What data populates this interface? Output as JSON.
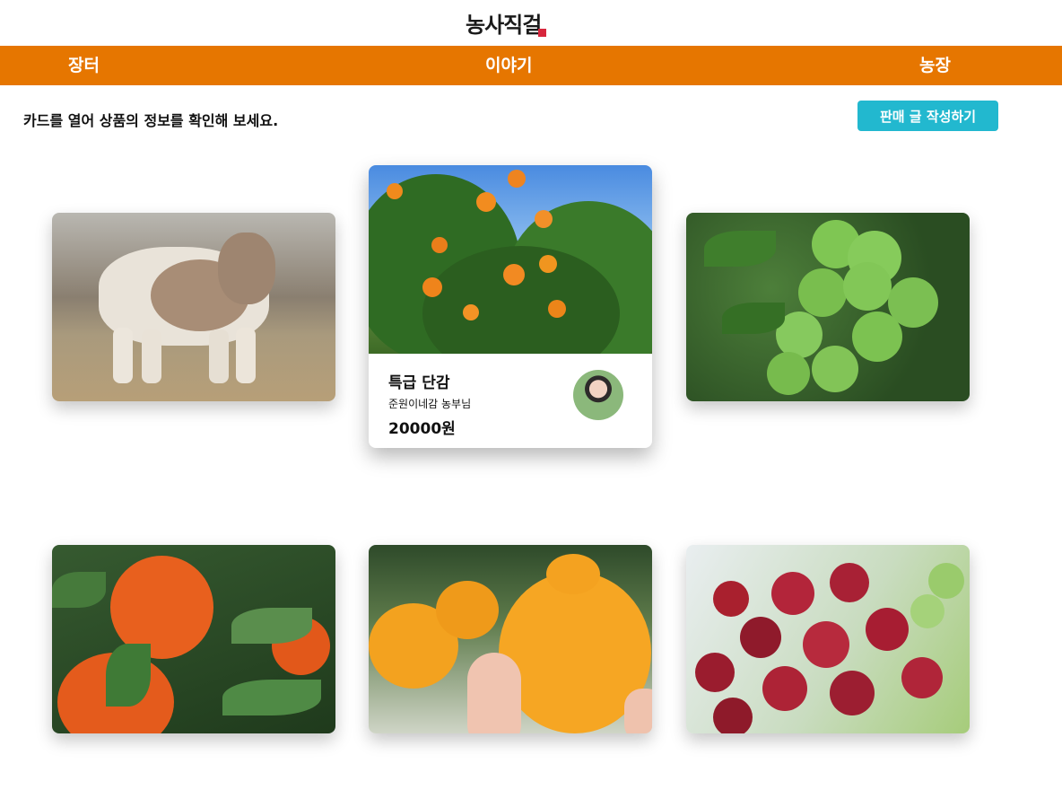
{
  "app": {
    "logo_text": "농사직걸"
  },
  "nav": {
    "items": [
      "장터",
      "이야기",
      "농장"
    ]
  },
  "main": {
    "instruction": "카드를 열어 상품의 정보를 확인해 보세요.",
    "write_button": "판매 글 작성하기"
  },
  "cards": [
    {
      "image": "calf-photo"
    },
    {
      "image": "persimmon-tree-photo",
      "title": "특급 단감",
      "farmer": "준원이네감 농부님",
      "price": "20000원"
    },
    {
      "image": "green-plums-photo"
    },
    {
      "image": "tangerines-photo"
    },
    {
      "image": "hallabong-photo"
    },
    {
      "image": "grapes-photo"
    }
  ],
  "colors": {
    "nav_bg": "#e67600",
    "button_bg": "#22b8cf"
  }
}
